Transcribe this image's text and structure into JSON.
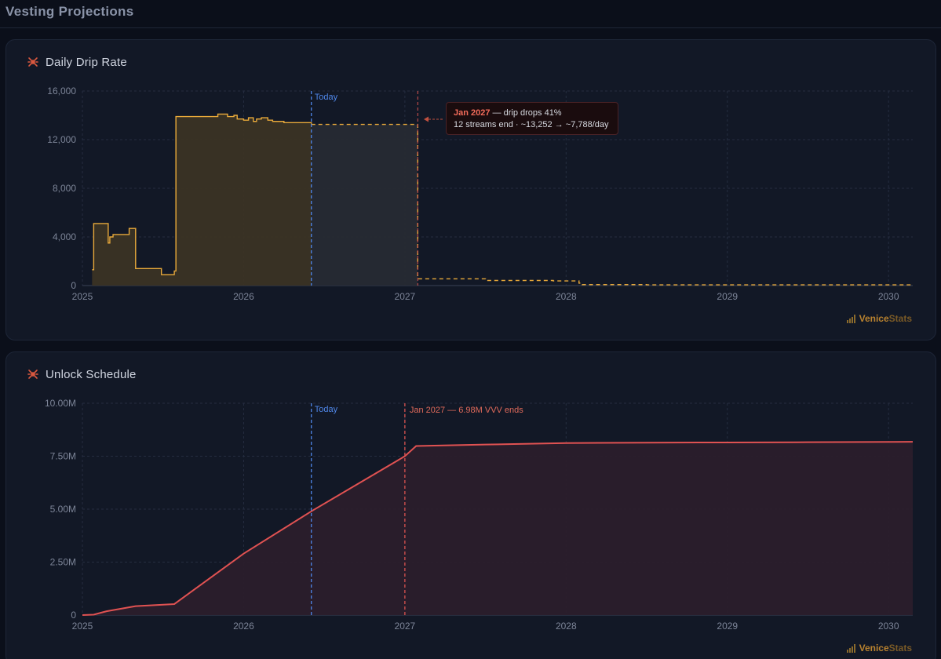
{
  "page": {
    "title": "Vesting Projections"
  },
  "brand": {
    "part1": "Venice",
    "part2": "Stats"
  },
  "colors": {
    "drip": "#e8a93a",
    "unlock": "#e05252",
    "today": "#4f86e8",
    "cliff": "#d9534f"
  },
  "chart_data": [
    {
      "type": "area",
      "title": "Daily Drip Rate",
      "xlabel": "",
      "ylabel": "",
      "xlim": [
        2025.0,
        2030.15
      ],
      "ylim": [
        0,
        16000
      ],
      "x_ticks": [
        "2025",
        "2026",
        "2027",
        "2028",
        "2029",
        "2030"
      ],
      "y_ticks": [
        "0",
        "4,000",
        "8,000",
        "12,000",
        "16,000"
      ],
      "grid": true,
      "step": true,
      "series": [
        {
          "style": "solid",
          "x": [
            2025.06,
            2025.07,
            2025.08,
            2025.16,
            2025.17,
            2025.19,
            2025.2,
            2025.29,
            2025.3,
            2025.33,
            2025.48,
            2025.49,
            2025.53,
            2025.57,
            2025.58,
            2025.83,
            2025.84,
            2025.88,
            2025.9,
            2025.94,
            2025.96,
            2026.0,
            2026.03,
            2026.06,
            2026.08,
            2026.11,
            2026.15,
            2026.18,
            2026.2,
            2026.25,
            2026.42
          ],
          "y": [
            1300,
            5100,
            5100,
            3500,
            4000,
            4200,
            4200,
            4700,
            4700,
            1400,
            1400,
            900,
            900,
            1200,
            13900,
            13900,
            14100,
            14100,
            13900,
            14000,
            13700,
            13600,
            13800,
            13500,
            13700,
            13800,
            13600,
            13500,
            13500,
            13400,
            13300
          ]
        },
        {
          "style": "dashed",
          "x": [
            2026.42,
            2026.9,
            2027.07,
            2027.08,
            2027.5,
            2027.92,
            2028.08,
            2028.1,
            2028.5,
            2030.15
          ],
          "y": [
            13252,
            13252,
            13252,
            550,
            420,
            380,
            200,
            80,
            60,
            50
          ]
        }
      ],
      "markers": [
        {
          "label": "Today",
          "x": 2026.42
        },
        {
          "label": "",
          "x": 2027.08
        }
      ],
      "annotation": {
        "date": "Jan 2027",
        "line1_rest": "— drip drops 41%",
        "line2": "12 streams end · ~13,252 → ~7,788/day"
      }
    },
    {
      "type": "area",
      "title": "Unlock Schedule",
      "xlabel": "",
      "ylabel": "",
      "xlim": [
        2025.0,
        2030.15
      ],
      "ylim": [
        0,
        10000000
      ],
      "x_ticks": [
        "2025",
        "2026",
        "2027",
        "2028",
        "2029",
        "2030"
      ],
      "y_ticks": [
        "0",
        "2.50M",
        "5.00M",
        "7.50M",
        "10.00M"
      ],
      "grid": true,
      "series": [
        {
          "x": [
            2025.0,
            2025.07,
            2025.15,
            2025.33,
            2025.57,
            2026.0,
            2026.42,
            2027.0,
            2027.07,
            2027.5,
            2028.0,
            2028.5,
            2029.0,
            2029.5,
            2030.15
          ],
          "y": [
            0,
            20000,
            180000,
            420000,
            520000,
            2900000,
            4900000,
            7500000,
            7980000,
            8050000,
            8120000,
            8140000,
            8150000,
            8160000,
            8180000
          ]
        }
      ],
      "markers": [
        {
          "label": "Today",
          "x": 2026.42
        },
        {
          "label": "Jan 2027 — 6.98M VVV ends",
          "x": 2027.0
        }
      ]
    }
  ]
}
